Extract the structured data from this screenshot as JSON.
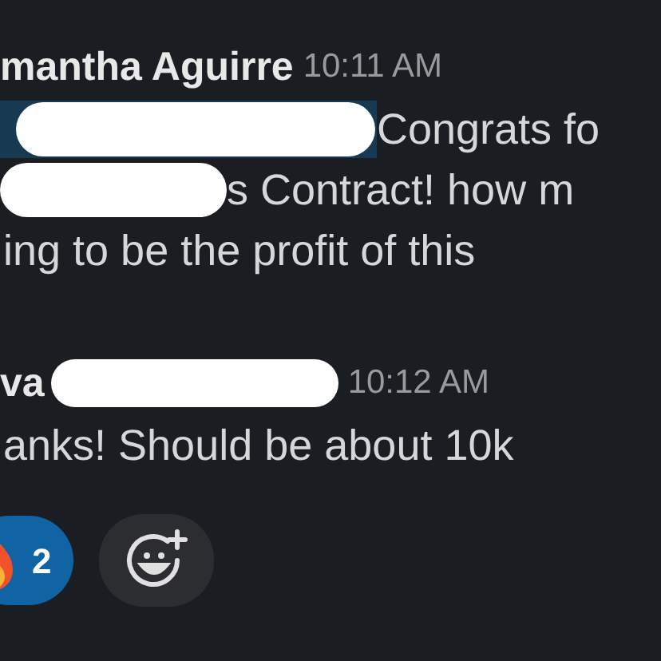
{
  "messages": [
    {
      "author": "mantha Aguirre",
      "time": "10:11 AM",
      "lines": [
        {
          "mention": true,
          "redacted": true,
          "text": "Congrats fo"
        },
        {
          "redacted": true,
          "text": "s Contract! how m"
        },
        {
          "text": "ing to be the profit of this"
        }
      ]
    },
    {
      "author": "va",
      "author_redacted": true,
      "time": "10:12 AM",
      "lines": [
        {
          "text": "anks! Should be about 10k"
        }
      ],
      "reactions": [
        {
          "count": "2",
          "selected": true
        }
      ]
    }
  ]
}
